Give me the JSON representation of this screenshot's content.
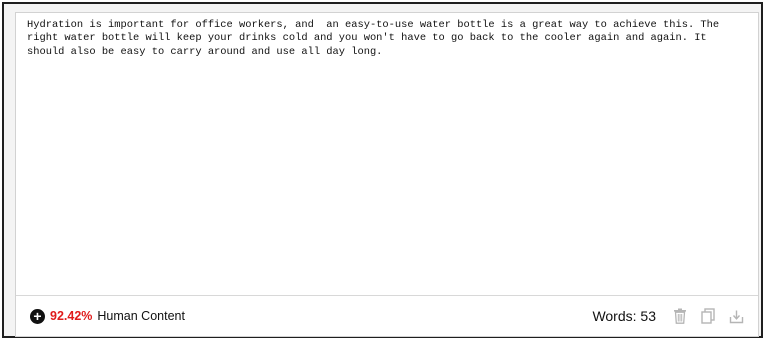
{
  "editor": {
    "text": "Hydration is important for office workers, and  an easy-to-use water bottle is a great way to achieve this. The right water bottle will keep your drinks cold and you won't have to go back to the cooler again and again. It should also be easy to carry around and use all day long."
  },
  "footer": {
    "score_icon": "plus-circle-icon",
    "score_percent": "92.42%",
    "score_label": "Human Content",
    "word_count_label": "Words:",
    "word_count": "53",
    "actions": [
      {
        "name": "trash-icon"
      },
      {
        "name": "copy-icon"
      },
      {
        "name": "download-icon"
      }
    ]
  },
  "colors": {
    "percent": "#e01b1b",
    "icon_gray": "#b5b5b5",
    "border": "#1f1f1f"
  }
}
